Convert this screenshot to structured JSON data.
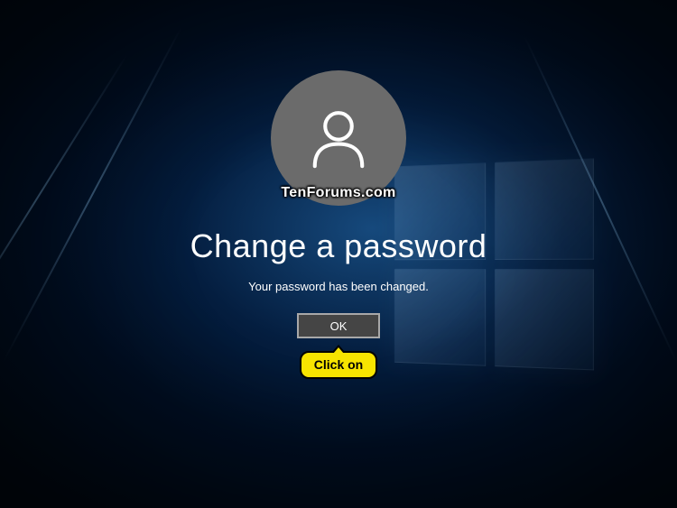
{
  "watermark": "TenForums.com",
  "heading": "Change a password",
  "status": "Your password has been changed.",
  "ok_label": "OK",
  "callout_text": "Click on"
}
